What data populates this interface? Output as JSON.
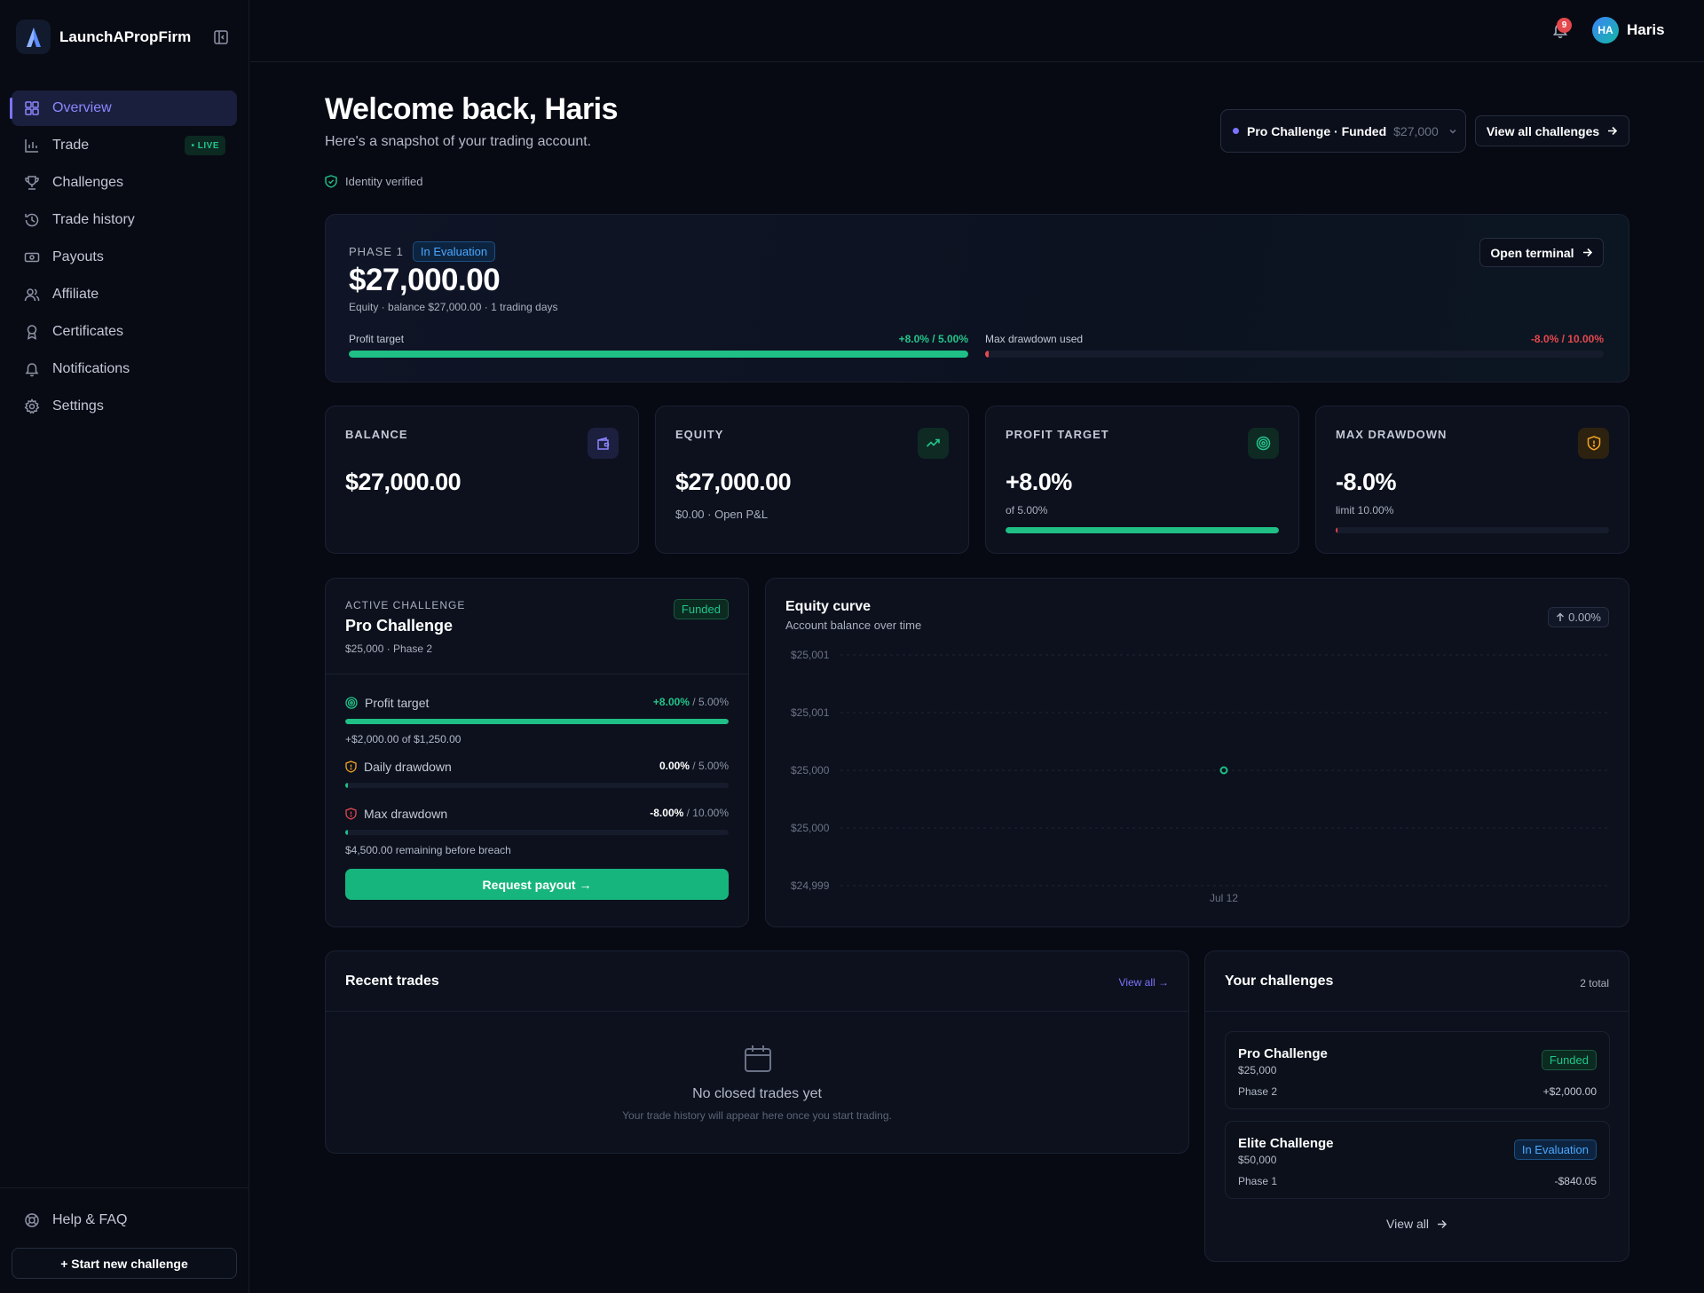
{
  "app": {
    "name": "LaunchAPropFirm"
  },
  "sidebar": {
    "items": [
      {
        "label": "Overview",
        "icon": "grid-icon",
        "active": true
      },
      {
        "label": "Trade",
        "icon": "chart-icon",
        "badge": "• LIVE"
      },
      {
        "label": "Challenges",
        "icon": "trophy-icon"
      },
      {
        "label": "Trade history",
        "icon": "history-icon"
      },
      {
        "label": "Payouts",
        "icon": "banknote-icon"
      },
      {
        "label": "Affiliate",
        "icon": "users-icon"
      },
      {
        "label": "Certificates",
        "icon": "award-icon"
      },
      {
        "label": "Notifications",
        "icon": "bell-icon"
      },
      {
        "label": "Settings",
        "icon": "gear-icon"
      }
    ],
    "help_label": "Help & FAQ",
    "start_button": "+ Start new challenge"
  },
  "topbar": {
    "notification_count": "9",
    "avatar_initials": "HA",
    "user_name": "Haris"
  },
  "header": {
    "title": "Welcome back, Haris",
    "subtitle": "Here's a snapshot of your trading account.",
    "verified": "Identity verified",
    "selector": {
      "name": "Pro Challenge · Funded",
      "amount": "$27,000"
    },
    "view_all_challenges": "View all challenges"
  },
  "phase_card": {
    "phase": "PHASE 1",
    "status": "In Evaluation",
    "amount": "$27,000.00",
    "meta": "Equity · balance $27,000.00 · 1 trading days",
    "open_terminal": "Open terminal",
    "profit_target": {
      "label": "Profit target",
      "value": "+8.0% / 5.00%",
      "progress": 1.0
    },
    "max_drawdown": {
      "label": "Max drawdown used",
      "value": "-8.0% / 10.00%",
      "progress": 0.0
    }
  },
  "stats": [
    {
      "label": "BALANCE",
      "value": "$27,000.00",
      "sub": "",
      "icon": "wallet-icon"
    },
    {
      "label": "EQUITY",
      "value": "$27,000.00",
      "sub": "$0.00 · Open P&L",
      "icon": "trending-up-icon"
    },
    {
      "label": "PROFIT TARGET",
      "value": "+8.0%",
      "sub": "of 5.00%",
      "icon": "target-icon",
      "progress": 1.0
    },
    {
      "label": "MAX DRAWDOWN",
      "value": "-8.0%",
      "sub": "limit 10.00%",
      "icon": "shield-icon",
      "progress": 0.0
    }
  ],
  "active_challenge": {
    "label": "ACTIVE CHALLENGE",
    "title": "Pro Challenge",
    "sub": "$25,000 · Phase 2",
    "status": "Funded",
    "profit_target": {
      "label": "Profit target",
      "value": "+8.00%",
      "limit": " / 5.00%",
      "note": "+$2,000.00 of $1,250.00",
      "progress": 1.0
    },
    "daily_drawdown": {
      "label": "Daily drawdown",
      "value": "0.00%",
      "limit": " / 5.00%",
      "progress": 0.0
    },
    "max_drawdown": {
      "label": "Max drawdown",
      "value": "-8.00%",
      "limit": " / 10.00%",
      "note": "$4,500.00 remaining before breach",
      "progress": 0.0
    },
    "payout_button": "Request payout →"
  },
  "equity_curve": {
    "title": "Equity curve",
    "subtitle": "Account balance over time",
    "change": "0.00%"
  },
  "chart_data": {
    "type": "line",
    "title": "Equity curve",
    "x": [
      "Jul 12"
    ],
    "series": [
      {
        "values": [
          25000
        ]
      }
    ],
    "y_ticks": [
      "$25,001",
      "$25,001",
      "$25,000",
      "$25,000",
      "$24,999"
    ],
    "ylim": [
      24999,
      25001
    ],
    "grid": true
  },
  "recent_trades": {
    "title": "Recent trades",
    "view_all": "View all →",
    "empty_title": "No closed trades yet",
    "empty_sub": "Your trade history will appear here once you start trading."
  },
  "your_challenges": {
    "title": "Your challenges",
    "total": "2 total",
    "items": [
      {
        "name": "Pro Challenge",
        "amount": "$25,000",
        "phase": "Phase 2",
        "pnl": "+$2,000.00",
        "status": "Funded"
      },
      {
        "name": "Elite Challenge",
        "amount": "$50,000",
        "phase": "Phase 1",
        "pnl": "-$840.05",
        "status": "In Evaluation"
      }
    ],
    "view_all": "View all"
  },
  "colors": {
    "accent": "#7b73ff",
    "green": "#1fbf86",
    "red": "#e5484d",
    "blue": "#4aa8ff",
    "amber": "#f5a524"
  }
}
